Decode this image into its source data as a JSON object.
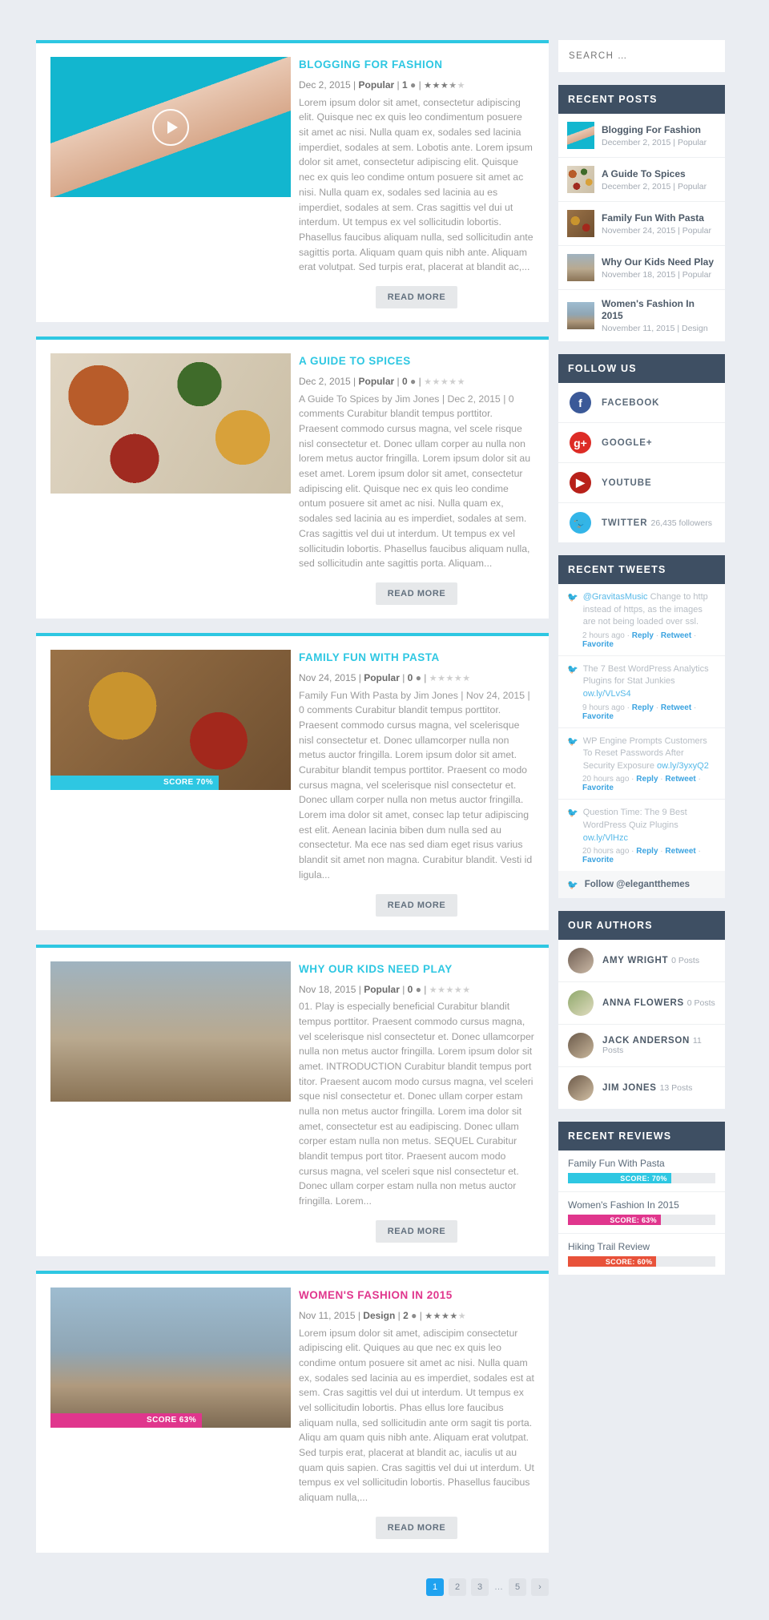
{
  "colors": {
    "accent_cyan": "#2ec7e2",
    "accent_pink": "#e0368d",
    "dark_header": "#3e4f63",
    "pagination_active": "#1fa2f0",
    "score_red": "#e8523a"
  },
  "posts": [
    {
      "title": "BLOGGING FOR FASHION",
      "title_color": "cyan",
      "date": "Dec 2, 2015",
      "category": "Popular",
      "comments": "1",
      "rating": 3.5,
      "has_video": true,
      "score": null,
      "excerpt": "Lorem ipsum dolor sit amet, consectetur adipiscing elit. Quisque nec ex quis leo condimentum posuere sit amet ac nisi. Nulla quam ex, sodales sed lacinia imperdiet, sodales at sem. Lobotis ante. Lorem ipsum dolor sit amet, consectetur adipiscing elit. Quisque nec ex quis leo condime ontum posuere sit amet ac nisi. Nulla quam ex, sodales sed lacinia au es imperdiet, sodales at sem. Cras sagittis vel dui ut interdum. Ut tempus ex vel sollicitudin lobortis. Phasellus faucibus aliquam nulla, sed sollicitudin ante sagittis porta. Aliquam quam quis nibh ante. Aliquam erat volutpat. Sed turpis erat, placerat at blandit ac,...",
      "read_more": "READ MORE"
    },
    {
      "title": "A GUIDE TO SPICES",
      "title_color": "cyan",
      "date": "Dec 2, 2015",
      "category": "Popular",
      "comments": "0",
      "rating": 0,
      "has_video": false,
      "score": null,
      "excerpt": "A Guide To Spices by Jim Jones | Dec 2, 2015 | 0 comments Curabitur blandit tempus porttitor. Praesent commodo cursus magna, vel scele risque nisl consectetur et. Donec ullam corper au nulla non lorem metus auctor fringilla. Lorem ipsum dolor sit au eset amet. Lorem ipsum dolor sit amet, consectetur adipiscing elit. Quisque nec ex quis leo condime ontum posuere sit amet ac nisi. Nulla quam ex, sodales sed lacinia au es imperdiet, sodales at sem. Cras sagittis vel dui ut interdum. Ut tempus ex vel sollicitudin lobortis. Phasellus faucibus aliquam nulla, sed sollicitudin ante sagittis porta. Aliquam...",
      "read_more": "READ MORE"
    },
    {
      "title": "FAMILY FUN WITH PASTA",
      "title_color": "cyan",
      "date": "Nov 24, 2015",
      "category": "Popular",
      "comments": "0",
      "rating": 0,
      "has_video": false,
      "score": {
        "label": "SCORE 70%",
        "percent": 70,
        "color": "#2ec7e2"
      },
      "excerpt": "Family Fun With Pasta by Jim Jones | Nov 24, 2015 | 0 comments Curabitur blandit tempus porttitor. Praesent commodo cursus magna, vel scelerisque nisl consectetur et. Donec ullamcorper nulla non metus auctor fringilla. Lorem ipsum dolor sit amet. Curabitur blandit tempus porttitor. Praesent co modo cursus magna, vel scelerisque nisl consectetur et. Donec ullam corper nulla non metus auctor fringilla. Lorem ima dolor sit amet, consec lap tetur adipiscing est elit. Aenean lacinia biben dum nulla sed au consectetur. Ma ece nas sed diam eget risus varius blandit sit amet non magna. Curabitur blandit. Vesti id ligula...",
      "read_more": "READ MORE"
    },
    {
      "title": "WHY OUR KIDS NEED PLAY",
      "title_color": "cyan",
      "date": "Nov 18, 2015",
      "category": "Popular",
      "comments": "0",
      "rating": 0,
      "has_video": false,
      "score": null,
      "excerpt": "01. Play is especially beneficial Curabitur blandit tempus porttitor. Praesent commodo cursus magna, vel scelerisque nisl consectetur et. Donec ullamcorper nulla non metus auctor fringilla. Lorem ipsum dolor sit amet. INTRODUCTION Curabitur blandit tempus port titor. Praesent aucom modo cursus magna, vel sceleri sque nisl consectetur et. Donec ullam corper estam nulla non metus auctor fringilla. Lorem ima dolor sit amet, consectetur est au eadipiscing. Donec ullam corper estam nulla non metus. SEQUEL Curabitur blandit tempus port titor. Praesent aucom modo cursus magna, vel sceleri sque nisl consectetur et. Donec ullam corper estam nulla non metus auctor fringilla. Lorem...",
      "read_more": "READ MORE"
    },
    {
      "title": "WOMEN'S FASHION IN 2015",
      "title_color": "pink",
      "date": "Nov 11, 2015",
      "category": "Design",
      "comments": "2",
      "rating": 4,
      "has_video": false,
      "score": {
        "label": "SCORE 63%",
        "percent": 63,
        "color": "#e0368d"
      },
      "excerpt": "Lorem ipsum dolor sit amet, adiscipim consectetur adipiscing elit. Quiques au que nec ex quis leo condime ontum posuere sit amet ac nisi. Nulla quam ex, sodales sed lacinia au es imperdiet, sodales est at sem. Cras sagittis vel dui ut interdum. Ut tempus ex vel sollicitudin lobortis. Phas ellus lore faucibus aliquam nulla, sed sollicitudin ante orm sagit tis porta. Aliqu am quam quis nibh ante. Aliquam erat volutpat. Sed turpis erat, placerat at blandit ac, iaculis ut au quam quis sapien. Cras sagittis vel dui ut interdum. Ut tempus ex vel sollicitudin lobortis. Phasellus faucibus aliquam nulla,...",
      "read_more": "READ MORE"
    }
  ],
  "pagination": {
    "items": [
      "1",
      "2",
      "3",
      "…",
      "5",
      "›"
    ],
    "active_index": 0
  },
  "sidebar": {
    "search": {
      "placeholder": "SEARCH …",
      "value": ""
    },
    "recent_posts": {
      "heading": "RECENT POSTS",
      "items": [
        {
          "title": "Blogging For Fashion",
          "meta": "December 2, 2015 | Popular"
        },
        {
          "title": "A Guide To Spices",
          "meta": "December 2, 2015 | Popular"
        },
        {
          "title": "Family Fun With Pasta",
          "meta": "November 24, 2015 | Popular"
        },
        {
          "title": "Why Our Kids Need Play",
          "meta": "November 18, 2015 | Popular"
        },
        {
          "title": "Women's Fashion In 2015",
          "meta": "November 11, 2015 | Design"
        }
      ]
    },
    "follow_us": {
      "heading": "FOLLOW US",
      "items": [
        {
          "label": "FACEBOOK",
          "sub": "",
          "glyph": "f",
          "color": "#3b5998",
          "icon": "facebook-icon"
        },
        {
          "label": "GOOGLE+",
          "sub": "",
          "glyph": "g+",
          "color": "#dd2c26",
          "icon": "googleplus-icon"
        },
        {
          "label": "YOUTUBE",
          "sub": "",
          "glyph": "▶",
          "color": "#b8211a",
          "icon": "youtube-icon"
        },
        {
          "label": "TWITTER",
          "sub": "26,435 followers",
          "glyph": "🐦",
          "color": "#33b5e8",
          "icon": "twitter-icon"
        }
      ]
    },
    "recent_tweets": {
      "heading": "RECENT TWEETS",
      "items": [
        {
          "handle": "@GravitasMusic",
          "text": " Change to http instead of https, as the images are not being loaded over ssl.",
          "link": "",
          "time": "2 hours ago",
          "actions": [
            "Reply",
            "Retweet",
            "Favorite"
          ]
        },
        {
          "handle": "",
          "text": "The 7 Best WordPress Analytics Plugins for Stat Junkies ",
          "link": "ow.ly/VLvS4",
          "time": "9 hours ago",
          "actions": [
            "Reply",
            "Retweet",
            "Favorite"
          ]
        },
        {
          "handle": "",
          "text": "WP Engine Prompts Customers To Reset Passwords After Security Exposure ",
          "link": "ow.ly/3yxyQ2",
          "time": "20 hours ago",
          "actions": [
            "Reply",
            "Retweet",
            "Favorite"
          ]
        },
        {
          "handle": "",
          "text": "Question Time: The 9 Best WordPress Quiz Plugins ",
          "link": "ow.ly/VlHzc",
          "time": "20 hours ago",
          "actions": [
            "Reply",
            "Retweet",
            "Favorite"
          ]
        }
      ],
      "follow_label": "Follow @elegantthemes"
    },
    "our_authors": {
      "heading": "OUR AUTHORS",
      "items": [
        {
          "name": "AMY WRIGHT",
          "posts": "0 Posts"
        },
        {
          "name": "ANNA FLOWERS",
          "posts": "0 Posts"
        },
        {
          "name": "JACK ANDERSON",
          "posts": "11 Posts"
        },
        {
          "name": "JIM JONES",
          "posts": "13 Posts"
        }
      ]
    },
    "recent_reviews": {
      "heading": "RECENT REVIEWS",
      "items": [
        {
          "title": "Family Fun With Pasta",
          "label": "SCORE: 70%",
          "percent": 70,
          "color": "#2ec7e2"
        },
        {
          "title": "Women's Fashion In 2015",
          "label": "SCORE: 63%",
          "percent": 63,
          "color": "#e0368d"
        },
        {
          "title": "Hiking Trail Review",
          "label": "SCORE: 60%",
          "percent": 60,
          "color": "#e8523a"
        }
      ]
    }
  }
}
